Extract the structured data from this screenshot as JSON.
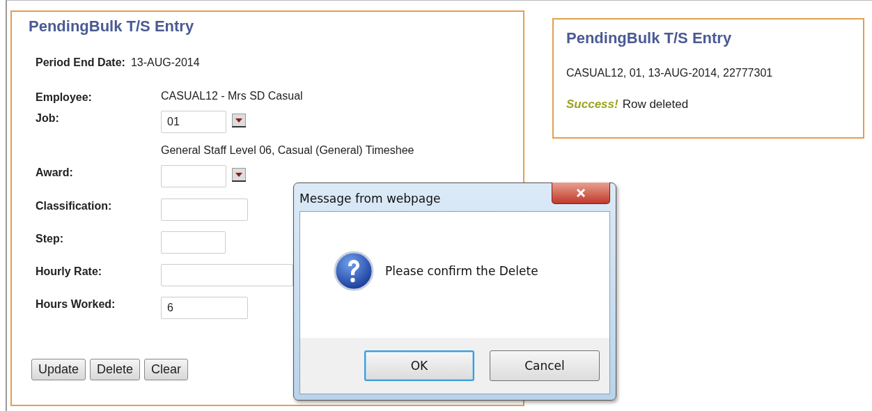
{
  "entry_form": {
    "title": "PendingBulk T/S Entry",
    "period_end": {
      "label": "Period End Date:",
      "value": "13-AUG-2014"
    },
    "fields": [
      {
        "kind": "text",
        "label": "Employee:",
        "value": "CASUAL12 - Mrs SD Casual"
      },
      {
        "kind": "select",
        "label": "Job:",
        "value": "01"
      },
      {
        "kind": "note",
        "value": "General Staff Level 06, Casual (General) Timeshee"
      },
      {
        "kind": "select",
        "label": "Award:"
      },
      {
        "kind": "input",
        "label": "Classification:"
      },
      {
        "kind": "input",
        "label": "Step:"
      },
      {
        "kind": "input",
        "label": "Hourly Rate:"
      },
      {
        "kind": "input",
        "label": "Hours Worked:",
        "value": "6"
      }
    ],
    "buttons": [
      "Update",
      "Delete",
      "Clear"
    ]
  },
  "result_panel": {
    "title": "PendingBulk T/S Entry",
    "summary": "CASUAL12, 01, 13-AUG-2014, 22777301",
    "status_label": "Success!",
    "status_text": "Row deleted"
  },
  "dialog": {
    "title": "Message from webpage",
    "message": "Please confirm the Delete",
    "buttons": [
      {
        "label": "OK",
        "selected": true
      },
      {
        "label": "Cancel",
        "selected": false
      }
    ]
  }
}
